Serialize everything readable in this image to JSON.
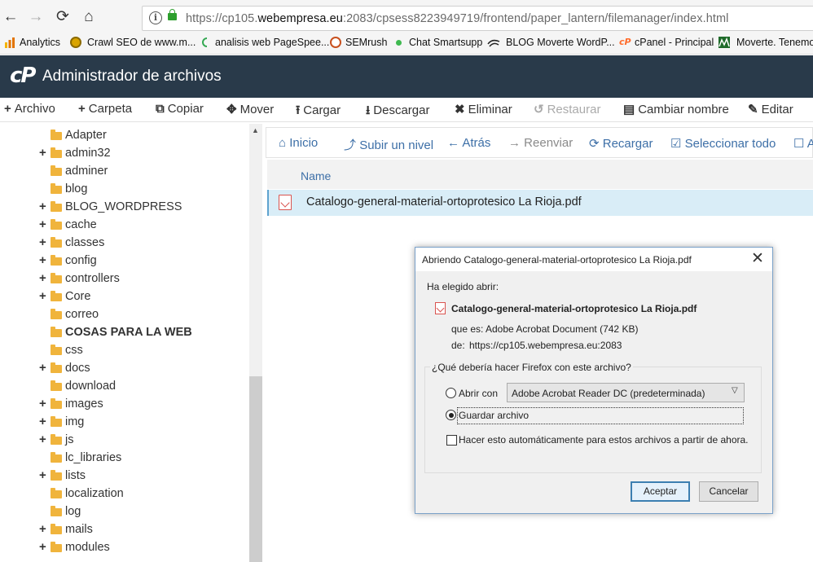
{
  "browser": {
    "url_prefix": "https://cp105.",
    "url_domain": "webempresa.eu",
    "url_suffix": ":2083/cpsess8223949719/frontend/paper_lantern/filemanager/index.html",
    "back_icon": "arrow-left-icon",
    "forward_icon": "arrow-right-icon",
    "reload_icon": "reload-icon",
    "home_icon": "home-icon"
  },
  "bookmarks": [
    {
      "label": "Analytics"
    },
    {
      "label": "Crawl SEO de www.m..."
    },
    {
      "label": "analisis web PageSpee..."
    },
    {
      "label": "SEMrush"
    },
    {
      "label": "Chat Smartsupp"
    },
    {
      "label": "BLOG Moverte WordP..."
    },
    {
      "label": "cPanel - Principal"
    },
    {
      "label": "Moverte. Tenemos"
    }
  ],
  "header": {
    "logo": "cP",
    "title": "Administrador de archivos"
  },
  "toolbar": [
    {
      "icon": "+",
      "label": "Archivo"
    },
    {
      "icon": "+",
      "label": "Carpeta"
    },
    {
      "icon": "⧉",
      "label": "Copiar"
    },
    {
      "icon": "✥",
      "label": "Mover"
    },
    {
      "icon": "⭱",
      "label": "Cargar"
    },
    {
      "icon": "⭳",
      "label": "Descargar"
    },
    {
      "icon": "✖",
      "label": "Eliminar"
    },
    {
      "icon": "↺",
      "label": "Restaurar"
    },
    {
      "icon": "▤",
      "label": "Cambiar nombre"
    },
    {
      "icon": "✎",
      "label": "Editar"
    }
  ],
  "tree": [
    {
      "label": "Adapter",
      "expandable": false
    },
    {
      "label": "admin32",
      "expandable": true
    },
    {
      "label": "adminer",
      "expandable": false
    },
    {
      "label": "blog",
      "expandable": false
    },
    {
      "label": "BLOG_WORDPRESS",
      "expandable": true
    },
    {
      "label": "cache",
      "expandable": true
    },
    {
      "label": "classes",
      "expandable": true
    },
    {
      "label": "config",
      "expandable": true
    },
    {
      "label": "controllers",
      "expandable": true
    },
    {
      "label": "Core",
      "expandable": true
    },
    {
      "label": "correo",
      "expandable": false
    },
    {
      "label": "COSAS PARA LA WEB",
      "expandable": false,
      "bold": true
    },
    {
      "label": "css",
      "expandable": false
    },
    {
      "label": "docs",
      "expandable": true
    },
    {
      "label": "download",
      "expandable": false
    },
    {
      "label": "images",
      "expandable": true
    },
    {
      "label": "img",
      "expandable": true
    },
    {
      "label": "js",
      "expandable": true
    },
    {
      "label": "lc_libraries",
      "expandable": false
    },
    {
      "label": "lists",
      "expandable": true
    },
    {
      "label": "localization",
      "expandable": false
    },
    {
      "label": "log",
      "expandable": false
    },
    {
      "label": "mails",
      "expandable": true
    },
    {
      "label": "modules",
      "expandable": true
    }
  ],
  "nav": [
    {
      "icon": "⌂",
      "label": "Inicio"
    },
    {
      "icon": "⤴",
      "label": "Subir un nivel"
    },
    {
      "icon": "←",
      "label": "Atrás"
    },
    {
      "icon": "→",
      "label": "Reenviar"
    },
    {
      "icon": "⟳",
      "label": "Recargar"
    },
    {
      "icon": "☑",
      "label": "Seleccionar todo"
    },
    {
      "icon": "☐",
      "label": "A"
    }
  ],
  "list": {
    "column_name": "Name",
    "files": [
      {
        "name": "Catalogo-general-material-ortoprotesico La Rioja.pdf",
        "icon": "pdf-file-icon"
      }
    ]
  },
  "dialog": {
    "title": "Abriendo Catalogo-general-material-ortoprotesico La Rioja.pdf",
    "chosen_label": "Ha elegido abrir:",
    "file_name": "Catalogo-general-material-ortoprotesico La Rioja.pdf",
    "type_label": "que es:",
    "type_value": "Adobe Acrobat Document (742 KB)",
    "from_label": "de:",
    "from_value": "https://cp105.webempresa.eu:2083",
    "question": "¿Qué debería hacer Firefox con este archivo?",
    "open_with_label": "Abrir con",
    "open_with_app": "Adobe Acrobat Reader DC  (predeterminada)",
    "save_label": "Guardar archivo",
    "auto_label": "Hacer esto automáticamente para estos archivos a partir de ahora.",
    "accept_label": "Aceptar",
    "cancel_label": "Cancelar",
    "selected_option": "save"
  }
}
